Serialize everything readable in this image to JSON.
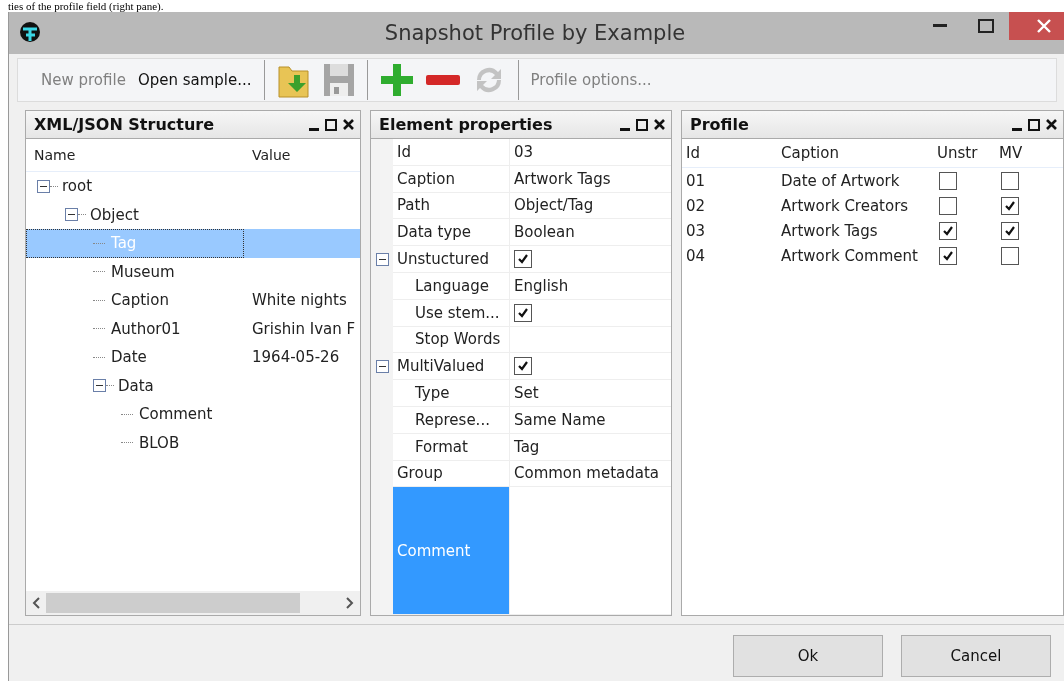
{
  "page_fragment": "ties of the profile field (right pane).",
  "window": {
    "title": "Snapshot Profile by Example"
  },
  "toolbar": [
    {
      "kind": "text",
      "label": "New profile",
      "disabled": true
    },
    {
      "kind": "text",
      "label": "Open sample...",
      "disabled": false
    },
    {
      "kind": "separator"
    },
    {
      "kind": "folder",
      "disabled": false
    },
    {
      "kind": "save",
      "disabled": true
    },
    {
      "kind": "separator"
    },
    {
      "kind": "add",
      "disabled": false
    },
    {
      "kind": "remove",
      "disabled": false
    },
    {
      "kind": "refresh",
      "disabled": true
    },
    {
      "kind": "separator"
    },
    {
      "kind": "text",
      "label": "Profile options...",
      "disabled": true
    }
  ],
  "structure": {
    "title": "XML/JSON Structure",
    "columns": [
      "Name",
      "Value"
    ],
    "tree": [
      {
        "name": "root",
        "expanded": true,
        "selected": false,
        "children": [
          {
            "name": "Object",
            "expanded": true,
            "selected": false,
            "children": [
              {
                "name": "Tag",
                "selected": true
              },
              {
                "name": "Museum",
                "selected": false
              },
              {
                "name": "Caption",
                "value": "White nights",
                "selected": false
              },
              {
                "name": "Author01",
                "value": "Grishin Ivan F",
                "selected": false
              },
              {
                "name": "Date",
                "value": "1964-05-26",
                "selected": false
              },
              {
                "name": "Data",
                "expanded": true,
                "selected": false,
                "children": [
                  {
                    "name": "Comment",
                    "selected": false
                  },
                  {
                    "name": "BLOB",
                    "selected": false
                  }
                ]
              }
            ]
          }
        ]
      }
    ]
  },
  "properties": {
    "title": "Element properties",
    "rows": [
      {
        "label": "Id",
        "value": "03"
      },
      {
        "label": "Caption",
        "value": "Artwork Tags"
      },
      {
        "label": "Path",
        "value": "Object/Tag"
      },
      {
        "label": "Data type",
        "value": "Boolean"
      },
      {
        "label": "Unstuctured",
        "checked": true,
        "expanded": true,
        "children": [
          {
            "label": "Language",
            "value": "English"
          },
          {
            "label": "Use stem...",
            "checked": true
          },
          {
            "label": "Stop Words"
          }
        ]
      },
      {
        "label": "MultiValued",
        "checked": true,
        "expanded": true,
        "children": [
          {
            "label": "Type",
            "value": "Set"
          },
          {
            "label": "Represe...",
            "value": "Same Name"
          },
          {
            "label": "Format",
            "value": "Tag"
          }
        ]
      },
      {
        "label": "Group",
        "value": "Common metadata"
      },
      {
        "label": "Comment",
        "selected": true,
        "kind": "memo"
      }
    ]
  },
  "profile": {
    "title": "Profile",
    "columns": [
      "Id",
      "Caption",
      "Unstr",
      "MV"
    ],
    "rows": [
      {
        "id": "01",
        "caption": "Date of Artwork",
        "unstructured": false,
        "multivalued": false
      },
      {
        "id": "02",
        "caption": "Artwork Creators",
        "unstructured": false,
        "multivalued": true
      },
      {
        "id": "03",
        "caption": "Artwork Tags",
        "unstructured": true,
        "multivalued": true
      },
      {
        "id": "04",
        "caption": "Artwork Comment",
        "unstructured": true,
        "multivalued": false
      }
    ]
  },
  "buttons": [
    "Ok",
    "Cancel"
  ]
}
